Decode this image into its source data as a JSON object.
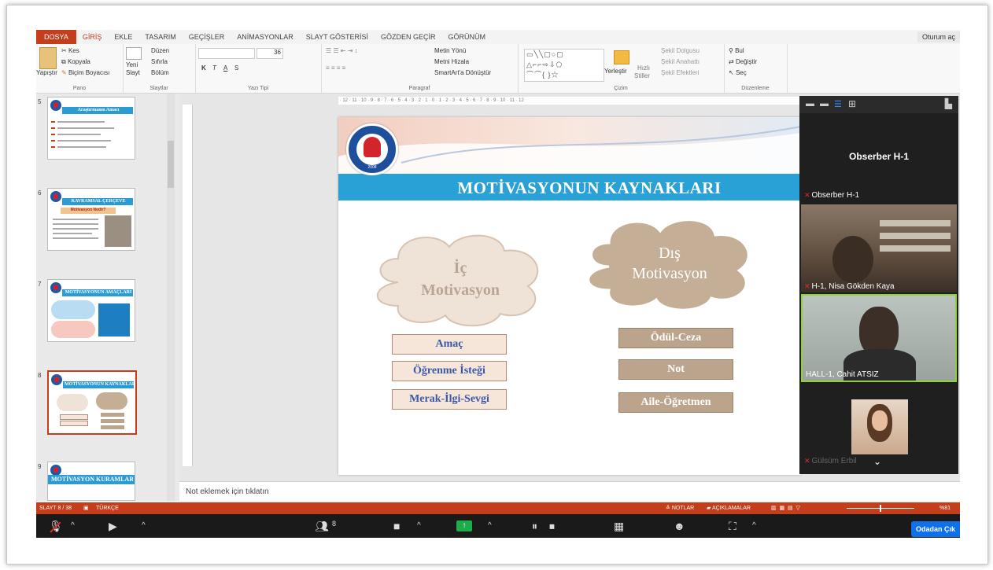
{
  "ribbon": {
    "tabs": [
      "DOSYA",
      "GİRİŞ",
      "EKLE",
      "TASARIM",
      "GEÇİŞLER",
      "ANİMASYONLAR",
      "SLAYT GÖSTERİSİ",
      "GÖZDEN GEÇİR",
      "GÖRÜNÜM"
    ],
    "signin": "Oturum aç",
    "pano": {
      "paste": "Yapıştır",
      "cut": "Kes",
      "copy": "Kopyala",
      "format_painter": "Biçim Boyacısı",
      "label": "Pano"
    },
    "slides": {
      "new_slide_1": "Yeni",
      "new_slide_2": "Slayt",
      "layout": "Düzen",
      "reset": "Sıfırla",
      "section": "Bölüm",
      "label": "Slaytlar"
    },
    "font": {
      "size": "36",
      "bold": "K",
      "italic": "T",
      "underline": "A",
      "shadow": "S",
      "label": "Yazı Tipi"
    },
    "paragraph": {
      "text_direction": "Metin Yönü",
      "align_text": "Metni Hizala",
      "smartart": "SmartArt'a Dönüştür",
      "label": "Paragraf"
    },
    "drawing": {
      "arrange": "Yerleştir",
      "quick_styles_1": "Hızlı",
      "quick_styles_2": "Stiller",
      "shape_fill": "Şekil Dolgusu",
      "shape_outline": "Şekil Anahattı",
      "shape_effects": "Şekil Efektleri",
      "label": "Çizim"
    },
    "editing": {
      "find": "Bul",
      "replace": "Değiştir",
      "select": "Seç",
      "label": "Düzenleme"
    }
  },
  "thumbnails": [
    {
      "num": "5",
      "title": "Araştırmanın Amacı"
    },
    {
      "num": "6",
      "title": "KAVRAMSAL ÇERÇEVE",
      "subtitle": "Motivasyon Nedir?"
    },
    {
      "num": "7",
      "title": "MOTİVASYONUN AMAÇLARI"
    },
    {
      "num": "8",
      "title": "MOTİVASYONUN KAYNAKLARI"
    },
    {
      "num": "9",
      "title": "MOTİVASYON KURAMLARI"
    }
  ],
  "slide": {
    "title": "MOTİVASYONUN KAYNAKLARI",
    "logo_text": "HAKKARİ ÜNİVERSİTESİ",
    "logo_year": "2008",
    "left_cloud_line1": "İç",
    "left_cloud_line2": "Motivasyon",
    "right_cloud_line1": "Dış",
    "right_cloud_line2": "Motivasyon",
    "left_items": [
      "Amaç",
      "Öğrenme İsteği",
      "Merak-İlgi-Sevgi"
    ],
    "right_items": [
      "Ödül-Ceza",
      "Not",
      "Aile-Öğretmen"
    ]
  },
  "notes_placeholder": "Not eklemek için tıklatın",
  "status": {
    "slide": "SLAYT 8 / 38",
    "language": "TÜRKÇE",
    "notes": "NOTLAR",
    "comments": "AÇIKLAMALAR",
    "zoom": "%81"
  },
  "zoom_toolbar": {
    "participants": "8",
    "leave": "Odadan Çık"
  },
  "video_panel": {
    "active_name": "Obserber H-1",
    "tiles": [
      {
        "name": "Obserber H-1"
      },
      {
        "name": "H-1, Nisa Gökden Kaya"
      },
      {
        "name": "HALL-1, Cahit ATSIZ"
      },
      {
        "name": "Gülsüm Erbil"
      }
    ]
  },
  "colors": {
    "accent": "#c43e1c",
    "slide_blue": "#29a0d6",
    "cloud_left": "#efe2d6",
    "cloud_right": "#c4ae96",
    "zoom_blue": "#0e71eb"
  }
}
